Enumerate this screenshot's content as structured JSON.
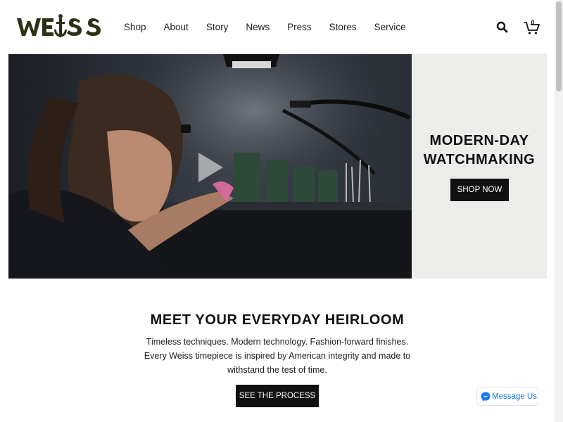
{
  "brand": {
    "logo_text": "WEISS"
  },
  "nav": {
    "items": [
      {
        "label": "Shop"
      },
      {
        "label": "About"
      },
      {
        "label": "Story"
      },
      {
        "label": "News"
      },
      {
        "label": "Press"
      },
      {
        "label": "Stores"
      },
      {
        "label": "Service"
      }
    ]
  },
  "header": {
    "search_icon": "search-icon",
    "cart_icon": "cart-icon",
    "cart_count": "0"
  },
  "hero": {
    "headline_line1": "MODERN-DAY",
    "headline_line2": "WATCHMAKING",
    "cta_label": "SHOP NOW",
    "video_icon": "play-icon"
  },
  "heirloom": {
    "title": "MEET YOUR EVERYDAY HEIRLOOM",
    "line1": "Timeless techniques. Modern technology. Fashion-forward finishes.",
    "line2": "Every Weiss timepiece is inspired by American integrity and made to",
    "line3": "withstand the test of time.",
    "cta_label": "SEE THE PROCESS"
  },
  "messenger": {
    "label": "Message Us",
    "icon": "messenger-icon"
  },
  "colors": {
    "brand_olive": "#2d3014",
    "button_black": "#111111",
    "panel_gray": "#ececea",
    "messenger_blue": "#1877f2"
  }
}
